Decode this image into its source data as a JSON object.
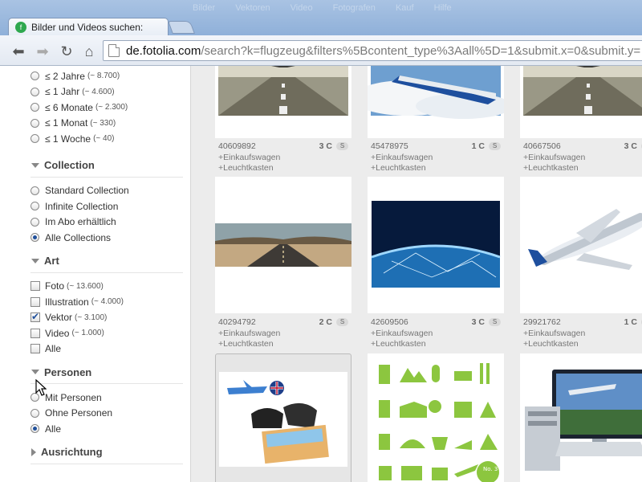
{
  "browser": {
    "tab_title": "Bilder und Videos suchen:",
    "favicon_label": "f",
    "url_host": "de.fotolia.com",
    "url_path": "/search?k=flugzeug&filters%5Bcontent_type%3Aall%5D=1&submit.x=0&submit.y=",
    "blurred_menu": [
      "Bilder",
      "Vektoren",
      "Video",
      "Fotografen",
      "Kauf",
      "Hilfe"
    ]
  },
  "sidebar": {
    "date_options": [
      {
        "label": "≤ 2 Jahre",
        "count": "(~ 8.700)"
      },
      {
        "label": "≤ 1 Jahr",
        "count": "(~ 4.600)"
      },
      {
        "label": "≤ 6 Monate",
        "count": "(~ 2.300)"
      },
      {
        "label": "≤ 1 Monat",
        "count": "(~ 330)"
      },
      {
        "label": "≤ 1 Woche",
        "count": "(~ 40)"
      }
    ],
    "collection": {
      "title": "Collection",
      "options": [
        "Standard Collection",
        "Infinite Collection",
        "Im Abo erhältlich",
        "Alle Collections"
      ],
      "selected": 3
    },
    "art": {
      "title": "Art",
      "options": [
        {
          "label": "Foto",
          "count": "(~ 13.600)"
        },
        {
          "label": "Illustration",
          "count": "(~ 4.000)"
        },
        {
          "label": "Vektor",
          "count": "(~ 3.100)"
        },
        {
          "label": "Video",
          "count": "(~ 1.000)"
        },
        {
          "label": "Alle",
          "count": ""
        }
      ],
      "checked": 2
    },
    "personen": {
      "title": "Personen",
      "options": [
        "Mit Personen",
        "Ohne Personen",
        "Alle"
      ],
      "selected": 2
    },
    "ausrichtung": {
      "title": "Ausrichtung"
    }
  },
  "results": {
    "add_cart": "+Einkaufswagen",
    "add_lightbox": "+Leuchtkasten",
    "badge": "S",
    "rows": [
      [
        {
          "id": "40609892",
          "credits": "3 C"
        },
        {
          "id": "45478975",
          "credits": "1 C"
        },
        {
          "id": "40667506",
          "credits": "3 C"
        }
      ],
      [
        {
          "id": "40294792",
          "credits": "2 C"
        },
        {
          "id": "42609506",
          "credits": "3 C"
        },
        {
          "id": "29921762",
          "credits": "1 C"
        }
      ]
    ]
  },
  "colors": {
    "accent_radio": "#1f4f9a",
    "favicon_green": "#2fa84f",
    "grid_background": "#ececec"
  }
}
